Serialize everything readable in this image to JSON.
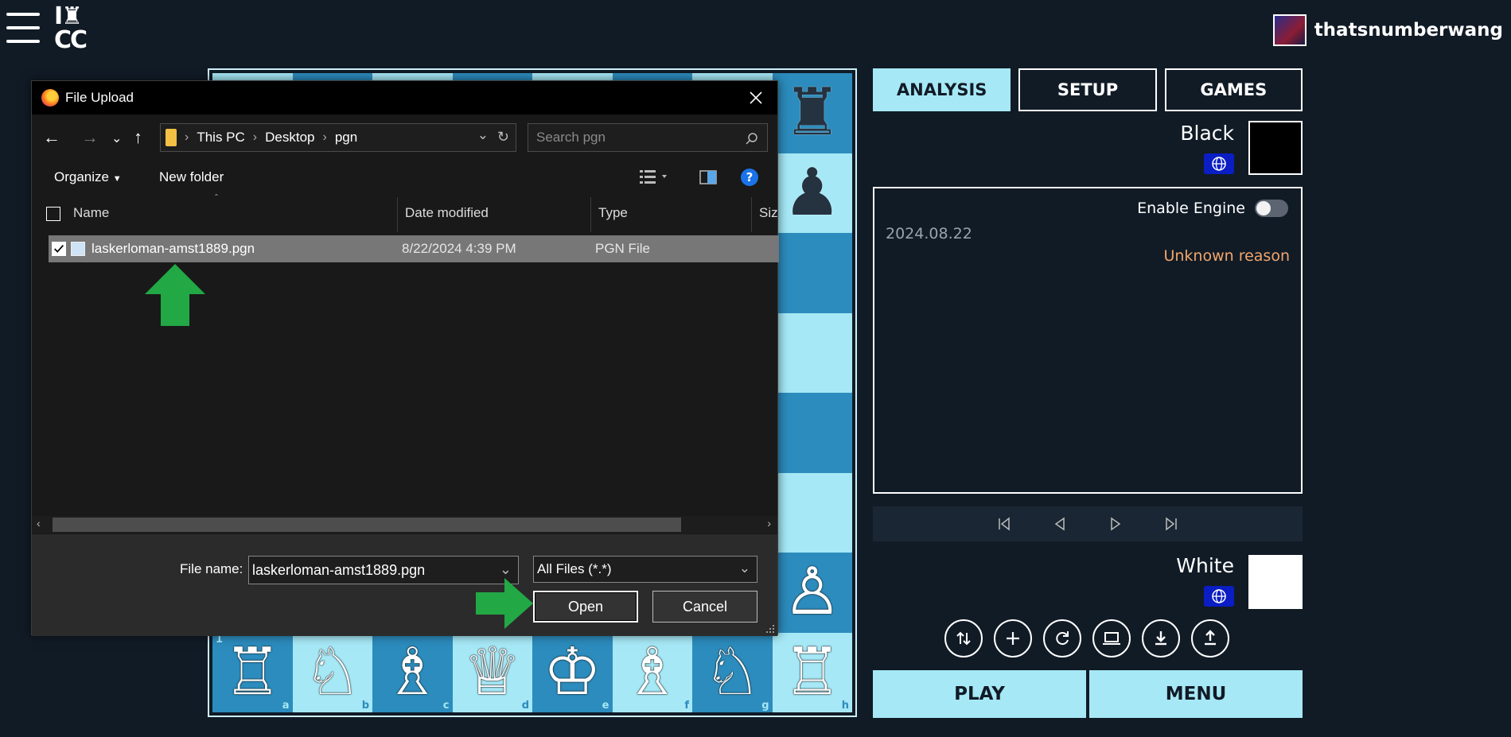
{
  "header": {
    "logo_line1": "I♜",
    "logo_line2": "CC",
    "username": "thatsnumberwang"
  },
  "board": {
    "files": [
      "a",
      "b",
      "c",
      "d",
      "e",
      "f",
      "g",
      "h"
    ],
    "rank_label": "1",
    "visible_pieces": [
      {
        "square": "h8",
        "glyph": "♜",
        "color": "black"
      },
      {
        "square": "h7",
        "glyph": "♟",
        "color": "black"
      },
      {
        "square": "h2",
        "glyph": "♙",
        "color": "white"
      },
      {
        "square": "a1",
        "glyph": "♖",
        "color": "white"
      },
      {
        "square": "b1",
        "glyph": "♘",
        "color": "white"
      },
      {
        "square": "c1",
        "glyph": "♗",
        "color": "white"
      },
      {
        "square": "d1",
        "glyph": "♕",
        "color": "white"
      },
      {
        "square": "e1",
        "glyph": "♔",
        "color": "white"
      },
      {
        "square": "f1",
        "glyph": "♗",
        "color": "white"
      },
      {
        "square": "g1",
        "glyph": "♘",
        "color": "white"
      },
      {
        "square": "h1",
        "glyph": "♖",
        "color": "white"
      }
    ]
  },
  "panel": {
    "tabs": [
      {
        "label": "ANALYSIS",
        "active": true
      },
      {
        "label": "SETUP",
        "active": false
      },
      {
        "label": "GAMES",
        "active": false
      }
    ],
    "black_player": "Black",
    "white_player": "White",
    "engine_label": "Enable Engine",
    "game_date": "2024.08.22",
    "result_text": "Unknown reason",
    "nav_icons": [
      "first-move-icon",
      "prev-move-icon",
      "next-move-icon",
      "last-move-icon"
    ],
    "tools": [
      "flip-board-icon",
      "add-icon",
      "reset-icon",
      "computer-icon",
      "download-icon",
      "upload-icon"
    ],
    "play_label": "PLAY",
    "menu_label": "MENU"
  },
  "dialog": {
    "title": "File Upload",
    "breadcrumb": [
      "This PC",
      "Desktop",
      "pgn"
    ],
    "search_placeholder": "Search pgn",
    "organize_label": "Organize",
    "new_folder_label": "New folder",
    "columns": {
      "name": "Name",
      "date": "Date modified",
      "type": "Type",
      "size": "Size"
    },
    "file": {
      "name": "laskerloman-amst1889.pgn",
      "date": "8/22/2024 4:39 PM",
      "type": "PGN File"
    },
    "filename_label": "File name:",
    "filename_value": "laskerloman-amst1889.pgn",
    "filetype_value": "All Files (*.*)",
    "open_label": "Open",
    "cancel_label": "Cancel"
  },
  "colors": {
    "background": "#111b26",
    "light_square": "#a6e8f6",
    "dark_square": "#2c8cbd",
    "accent": "#a6e8f6",
    "result_orange": "#f3a66b",
    "annotation_green": "#22a845"
  }
}
